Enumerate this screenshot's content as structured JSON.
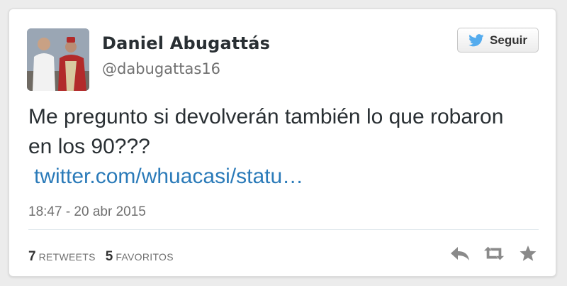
{
  "author": {
    "display_name": "Daniel Abugattás",
    "handle": "@dabugattas16"
  },
  "follow_button": {
    "label": "Seguir",
    "icon": "twitter-bird-icon"
  },
  "tweet": {
    "text": "Me pregunto si devolverán también lo que robaron en los 90???",
    "link": "twitter.com/whuacasi/statu…",
    "timestamp": "18:47 - 20 abr 2015"
  },
  "stats": {
    "retweets_count": "7",
    "retweets_label": "RETWEETS",
    "favorites_count": "5",
    "favorites_label": "FAVORITOS"
  },
  "actions": [
    "reply-icon",
    "retweet-icon",
    "favorite-star-icon"
  ],
  "colors": {
    "link": "#2b7bb9",
    "twitter_blue": "#55acee",
    "text": "#292f33",
    "muted": "#707070"
  }
}
